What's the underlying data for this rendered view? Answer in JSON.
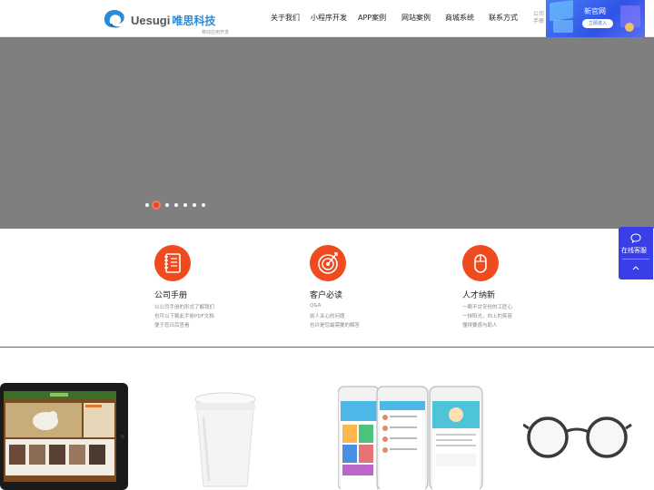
{
  "header": {
    "logo_en": "Uesugi",
    "logo_cn": "唯思科技",
    "logo_tagline": "移动应用开发",
    "nav": [
      {
        "label": "关于我们"
      },
      {
        "label": "小程序开发"
      },
      {
        "label": "APP案例"
      },
      {
        "label": "网站案例"
      },
      {
        "label": "商城系统"
      },
      {
        "label": "联系方式"
      }
    ],
    "nav_small": "公司手册"
  },
  "promo": {
    "title": "新官网",
    "button": "立即进入"
  },
  "banner": {
    "color": "#7f7f7f",
    "slide_count": 7,
    "active_slide": 2
  },
  "side_widget": {
    "label": "在线客服",
    "accent": "#3a3ee8"
  },
  "features": [
    {
      "icon": "notebook-icon",
      "title": "公司手册",
      "lines": [
        "以公司手册的形式了解我们",
        "也可以下载此手册PDF文档",
        "便于您日后查看"
      ]
    },
    {
      "icon": "target-icon",
      "title": "客户必读",
      "lines": [
        "Q&A",
        "前人关心的问题",
        "也许是您最需要的解答"
      ]
    },
    {
      "icon": "mouse-icon",
      "title": "人才纳新",
      "lines": [
        "一颗不甘安份的工匠心",
        "一抹阳光，向上的笑容",
        "懂得要感与助人"
      ]
    }
  ],
  "accent_color": "#f04a1f",
  "products": [
    {
      "name": "tablet-image"
    },
    {
      "name": "coffee-cup-image"
    },
    {
      "name": "phones-image"
    },
    {
      "name": "glasses-image"
    }
  ]
}
